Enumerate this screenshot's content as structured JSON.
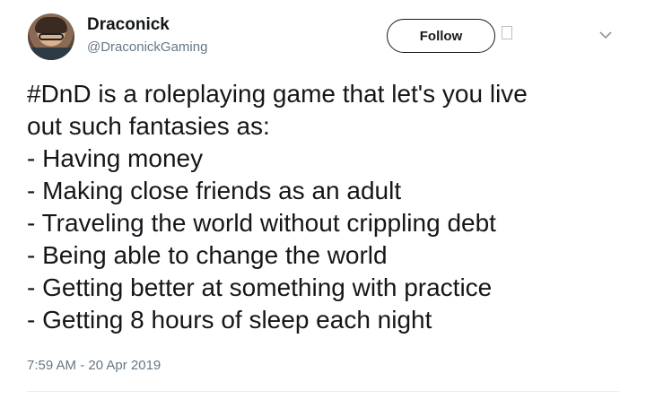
{
  "author": {
    "display_name": "Draconick",
    "handle": "@DraconickGaming"
  },
  "follow_button": {
    "label": "Follow"
  },
  "icons": {
    "avatar": "user-avatar",
    "block": "block-icon",
    "menu": "chevron-down-icon"
  },
  "tweet": {
    "hashtag": "#DnD",
    "lines": [
      " is a roleplaying game that let's you live",
      "out such fantasies as:",
      "- Having money",
      "- Making close friends as an adult",
      "- Traveling the world without crippling debt",
      "- Being able to change the world",
      "- Getting better at something with practice",
      "- Getting 8 hours of sleep each night"
    ]
  },
  "timestamp": "7:59 AM - 20 Apr 2019"
}
